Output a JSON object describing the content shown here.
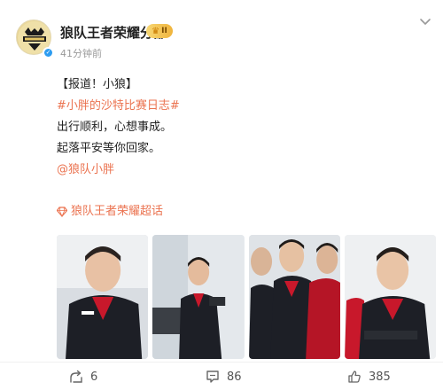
{
  "post": {
    "author": "狼队王者荣耀分部",
    "vip_level": "II",
    "time": "41分钟前",
    "lines": [
      "【报道！小狼】",
      "#小胖的沙特比赛日志#",
      "出行顺利，心想事成。",
      "起落平安等你回家。",
      "@狼队小胖"
    ],
    "supertopic": "狼队王者荣耀超话"
  },
  "images": [
    {
      "alt": "player-photo-1"
    },
    {
      "alt": "player-photo-2"
    },
    {
      "alt": "player-photo-3"
    },
    {
      "alt": "player-photo-4"
    }
  ],
  "actions": {
    "repost_count": "6",
    "comment_count": "86",
    "like_count": "385"
  },
  "colors": {
    "link": "#eb7350",
    "verify": "#2d9cf0",
    "jersey_red": "#c8182b",
    "jersey_black": "#1d1f26"
  },
  "icons": [
    "wolf-logo-icon",
    "verified-icon",
    "crown-icon",
    "chevron-down-icon",
    "gem-icon",
    "repost-icon",
    "comment-icon",
    "like-icon"
  ]
}
